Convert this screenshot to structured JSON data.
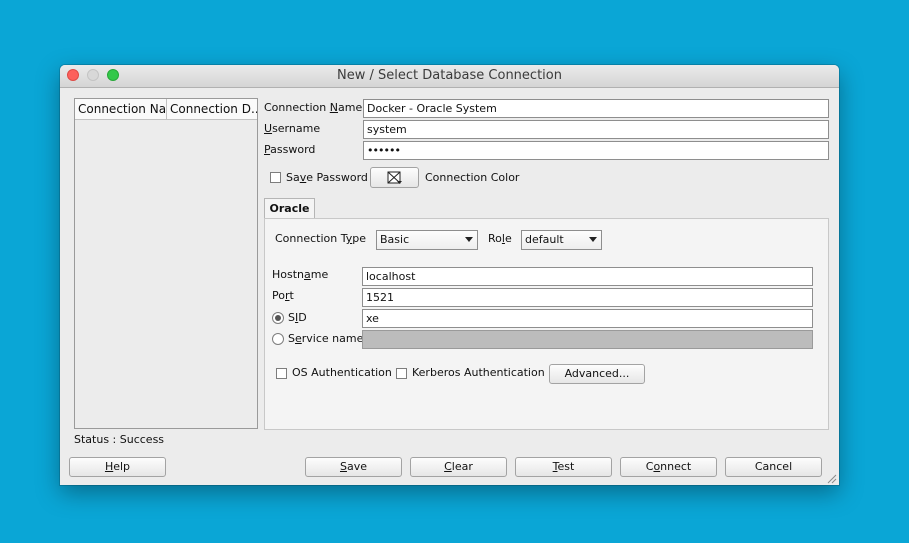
{
  "window": {
    "title": "New / Select Database Connection"
  },
  "connection_list": {
    "columns": [
      "Connection Na...",
      "Connection D..."
    ]
  },
  "form": {
    "connection_name": {
      "label_pre": "Connection ",
      "label_u": "N",
      "label_post": "ame",
      "value": "Docker - Oracle System"
    },
    "username": {
      "label_pre": "",
      "label_u": "U",
      "label_post": "sername",
      "value": "system"
    },
    "password": {
      "label_pre": "",
      "label_u": "P",
      "label_post": "assword",
      "value": "••••••"
    },
    "save_password": {
      "label_pre": "Sa",
      "label_u": "v",
      "label_post": "e Password",
      "checked": false
    },
    "connection_color": {
      "label": "Connection Color"
    }
  },
  "tab": {
    "label": "Oracle"
  },
  "oracle": {
    "connection_type": {
      "label_pre": "Connection T",
      "label_u": "y",
      "label_post": "pe",
      "value": "Basic"
    },
    "role": {
      "label_pre": "Ro",
      "label_u": "l",
      "label_post": "e",
      "value": "default"
    },
    "hostname": {
      "label_pre": "Hostn",
      "label_u": "a",
      "label_post": "me",
      "value": "localhost"
    },
    "port": {
      "label_pre": "Po",
      "label_u": "r",
      "label_post": "t",
      "value": "1521"
    },
    "sid": {
      "label_pre": "S",
      "label_u": "I",
      "label_post": "D",
      "value": "xe",
      "selected": true
    },
    "service_name": {
      "label_pre": "S",
      "label_u": "e",
      "label_post": "rvice name",
      "value": "",
      "selected": false
    },
    "os_auth": {
      "label": "OS Authentication",
      "checked": false
    },
    "kerberos_auth": {
      "label": "Kerberos Authentication",
      "checked": false
    },
    "advanced_button": {
      "label": "Advanced..."
    }
  },
  "status": {
    "text": "Status : Success"
  },
  "buttons": {
    "help": {
      "u": "H",
      "rest": "elp"
    },
    "save": {
      "u": "S",
      "rest": "ave"
    },
    "clear": {
      "u": "C",
      "rest": "lear"
    },
    "test": {
      "u": "T",
      "rest": "est"
    },
    "connect": {
      "pre": "C",
      "u": "o",
      "rest": "nnect"
    },
    "cancel": {
      "label": "Cancel"
    }
  },
  "colors": {
    "desktop": "#0aa6d6",
    "window": "#ececec"
  }
}
